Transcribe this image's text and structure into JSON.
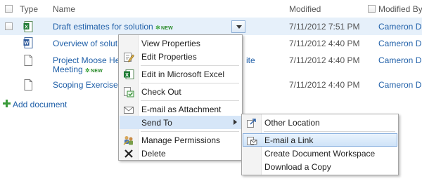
{
  "header": {
    "type": "Type",
    "name": "Name",
    "modified": "Modified",
    "modified_by": "Modified By"
  },
  "rows": [
    {
      "name": "Draft estimates for solution",
      "badge": "NEW",
      "modified": "7/11/2012 7:51 PM",
      "modified_by": "Cameron D",
      "icon": "excel-icon"
    },
    {
      "name": "Overview of solut",
      "badge": "",
      "modified": "7/11/2012 4:40 PM",
      "modified_by": "Cameron D",
      "icon": "word-icon"
    },
    {
      "name": "Project Moose He",
      "name_tail": "ite",
      "name_line2": "Meeting",
      "badge": "NEW",
      "modified": "7/11/2012 4:40 PM",
      "modified_by": "Cameron D",
      "icon": "document-icon"
    },
    {
      "name": "Scoping Exercise",
      "badge": "",
      "modified": "7/11/2012 4:40 PM",
      "modified_by": "Cameron D",
      "icon": "document-icon"
    }
  ],
  "add_document": "Add document",
  "context_menu": {
    "items": [
      {
        "label": "View Properties",
        "icon": ""
      },
      {
        "label": "Edit Properties",
        "icon": "edit-icon"
      },
      {
        "label": "Edit in Microsoft Excel",
        "icon": "excel-icon"
      },
      {
        "label": "Check Out",
        "icon": "checkout-icon"
      },
      {
        "label": "E-mail as Attachment",
        "icon": "email-icon"
      },
      {
        "label": "Send To",
        "icon": ""
      },
      {
        "label": "Manage Permissions",
        "icon": "permissions-icon"
      },
      {
        "label": "Delete",
        "icon": "delete-icon"
      }
    ]
  },
  "submenu": {
    "items": [
      {
        "label": "Other Location",
        "icon": "send-icon"
      },
      {
        "label": "E-mail a Link",
        "icon": "email-link-icon"
      },
      {
        "label": "Create Document Workspace",
        "icon": ""
      },
      {
        "label": "Download a Copy",
        "icon": ""
      }
    ]
  },
  "colors": {
    "link": "#1f5fa8",
    "selection": "#cfe3f8",
    "row_highlight": "#e6f0fa",
    "new_badge": "#2d8c2d"
  }
}
